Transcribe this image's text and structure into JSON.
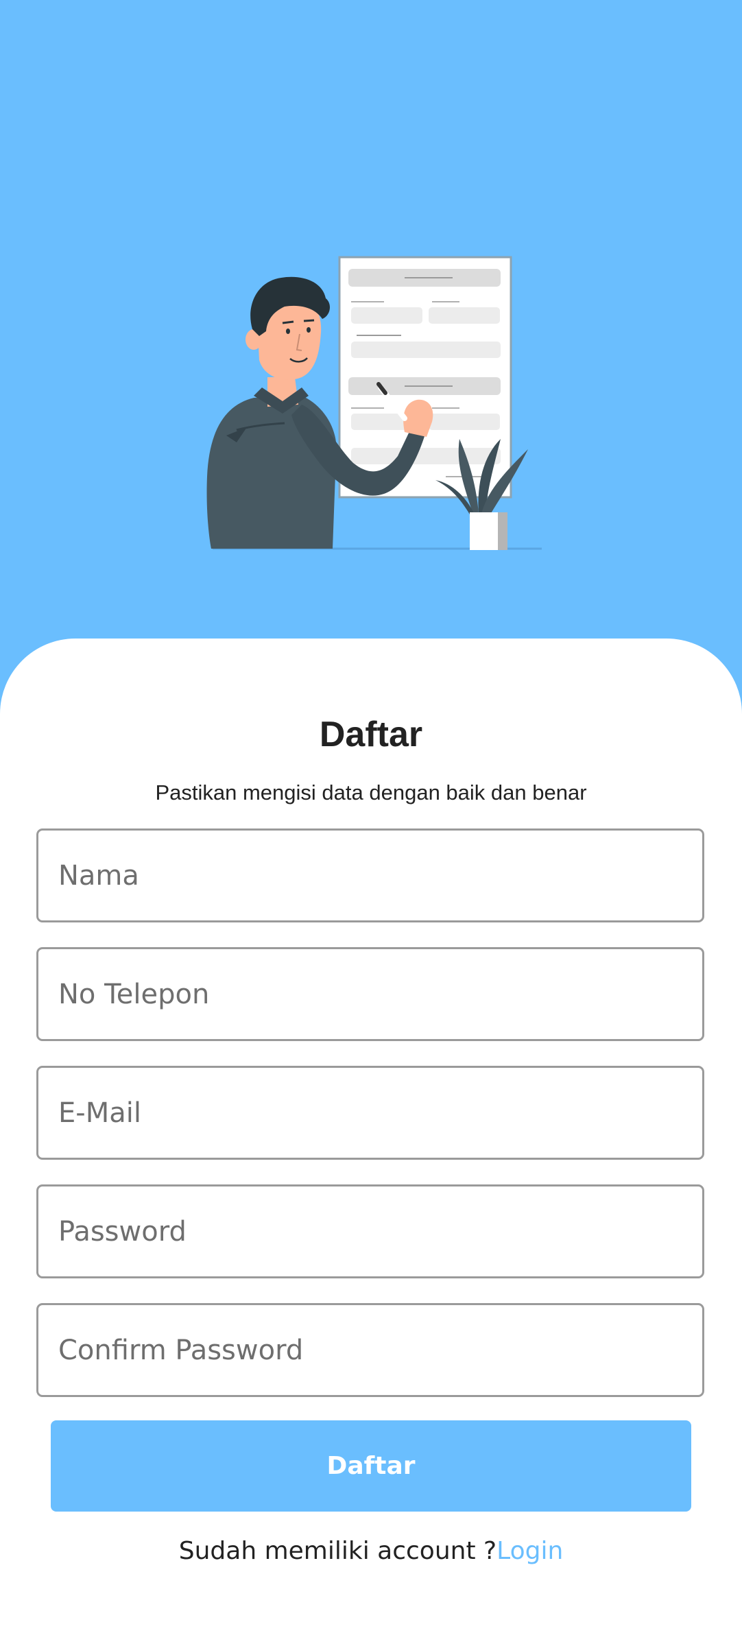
{
  "colors": {
    "accent": "#6ABEFE",
    "text": "#222222",
    "placeholder": "#6e6e6e",
    "shirt": "#475962",
    "skin": "#FDB797"
  },
  "hero": {
    "illustration": "person-signing-form-illustration"
  },
  "form": {
    "title": "Daftar",
    "subtitle": "Pastikan mengisi data dengan baik dan benar",
    "fields": [
      {
        "placeholder": "Nama",
        "value": ""
      },
      {
        "placeholder": "No Telepon",
        "value": ""
      },
      {
        "placeholder": "E-Mail",
        "value": ""
      },
      {
        "placeholder": "Password",
        "value": ""
      },
      {
        "placeholder": "Confirm Password",
        "value": ""
      }
    ],
    "submit_label": "Daftar"
  },
  "footer": {
    "prompt": "Sudah memiliki account ?",
    "login_label": "Login"
  }
}
